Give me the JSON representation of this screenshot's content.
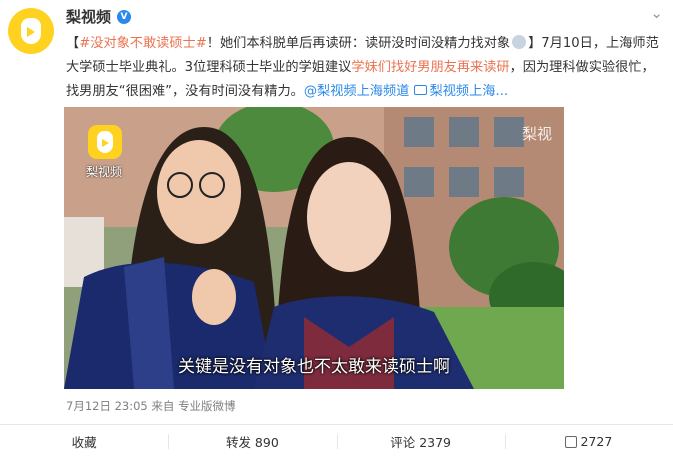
{
  "author": {
    "name": "梨视频",
    "verified_badge": "V"
  },
  "post": {
    "hashtag": "#没对象不敢读硕士#",
    "segment_1": "！她们本科脱单后再读研：读研没时间没精力找对象",
    "segment_2": "】7月10日，上海师范大学硕士毕业典礼。3位理科硕士毕业的学姐建议",
    "highlight": "学妹们找好男朋友再来读研",
    "segment_3": "，因为理科做实验很忙，找男朋友“很困难”，没有时间没有精力。",
    "mention": "@梨视频上海频道",
    "video_link": "梨视频上海..."
  },
  "video": {
    "watermark_text": "梨视频",
    "corner_watermark": "梨视",
    "subtitle": "关键是没有对象也不太敢来读硕士啊"
  },
  "meta": {
    "timestamp": "7月12日 23:05",
    "source_prefix": "来自",
    "source": "专业版微博"
  },
  "actions": {
    "favorite": "收藏",
    "repost": "转发 890",
    "comment": "评论 2379",
    "like": "2727"
  },
  "colors": {
    "link": "#eb7350",
    "blue": "#2b8ae9",
    "brand_yellow": "#ffd21f"
  },
  "icons": [
    "pear-video-logo",
    "verified-icon",
    "chevron-down-icon",
    "face-emoji-icon",
    "video-link-icon",
    "thumb-up-icon"
  ]
}
